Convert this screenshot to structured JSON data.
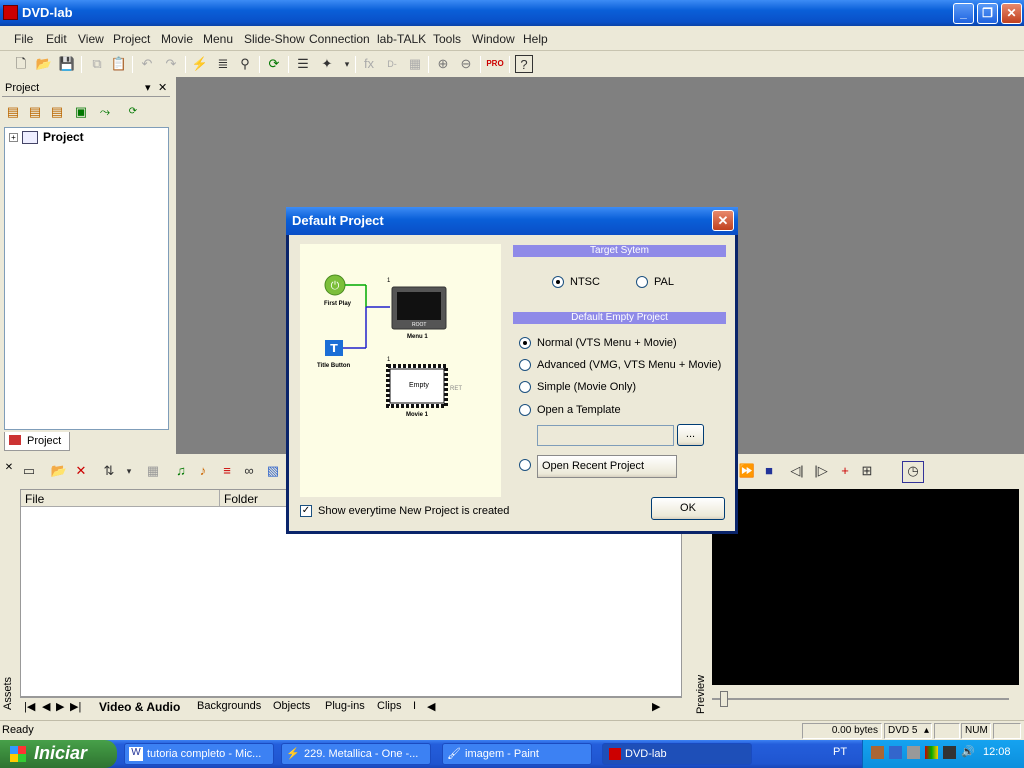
{
  "window": {
    "title": "DVD-lab"
  },
  "menu": [
    "File",
    "Edit",
    "View",
    "Project",
    "Movie",
    "Menu",
    "Slide-Show",
    "Connection",
    "lab-TALK",
    "Tools",
    "Window",
    "Help"
  ],
  "project_panel": {
    "title": "Project",
    "tree_root": "Project",
    "tab": "Project"
  },
  "assets_panel": {
    "label": "Assets",
    "columns": [
      "File",
      "Folder"
    ],
    "tabs": [
      "Video & Audio",
      "Backgrounds",
      "Objects",
      "Plug-ins",
      "Clips",
      "I"
    ]
  },
  "preview_panel": {
    "label": "Preview"
  },
  "status": {
    "ready": "Ready",
    "size": "0.00 bytes",
    "disc": "DVD 5",
    "num": "NUM"
  },
  "taskbar": {
    "start": "Iniciar",
    "items": [
      "tutoria completo - Mic...",
      "229. Metallica - One -...",
      "imagem - Paint",
      "DVD-lab"
    ],
    "lang": "PT",
    "clock": "12:08"
  },
  "dialog": {
    "title": "Default Project",
    "target_header": "Target Sytem",
    "target_options": [
      "NTSC",
      "PAL"
    ],
    "target_selected": "NTSC",
    "empty_header": "Default Empty Project",
    "project_options": [
      "Normal (VTS Menu + Movie)",
      "Advanced (VMG, VTS Menu + Movie)",
      "Simple (Movie Only)",
      "Open a Template"
    ],
    "project_selected": "Normal (VTS Menu + Movie)",
    "template_path": "",
    "browse_label": "...",
    "recent_label": "Open Recent Project",
    "show_checkbox": "Show everytime New Project is created",
    "show_checked": true,
    "ok_label": "OK",
    "diagram": {
      "first_play": "First Play",
      "title_button": "Title Button",
      "menu_label": "Menu 1",
      "menu_root": "ROOT",
      "menu_num": "1",
      "movie_label": "Movie 1",
      "movie_num": "1",
      "empty": "Empty",
      "ret": "RET"
    }
  }
}
